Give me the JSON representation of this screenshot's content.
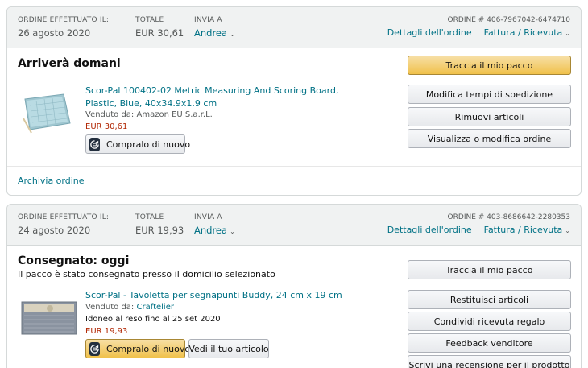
{
  "orders": [
    {
      "header": {
        "placed_label": "ORDINE EFFETTUATO IL:",
        "placed_value": "26 agosto 2020",
        "total_label": "TOTALE",
        "total_value": "EUR 30,61",
        "ship_label": "INVIA A",
        "ship_value": "Andrea",
        "order_number_label": "ORDINE # 406-7967042-6474710",
        "details_link": "Dettagli dell'ordine",
        "invoice_link": "Fattura / Ricevuta"
      },
      "status": "Arriverà domani",
      "item": {
        "title": "Scor-Pal 100402-02 Metric Measuring And Scoring Board, Plastic, Blue, 40x34.9x1.9 cm",
        "seller_prefix": "Venduto da:",
        "seller": "Amazon EU S.a.r.L.",
        "price": "EUR 30,61",
        "buy_again": "Compralo di nuovo"
      },
      "actions": [
        "Traccia il mio pacco",
        "Modifica tempi di spedizione",
        "Rimuovi articoli",
        "Visualizza o modifica ordine"
      ],
      "footer_link": "Archivia ordine"
    },
    {
      "header": {
        "placed_label": "ORDINE EFFETTUATO IL:",
        "placed_value": "24 agosto 2020",
        "total_label": "TOTALE",
        "total_value": "EUR 19,93",
        "ship_label": "INVIA A",
        "ship_value": "Andrea",
        "order_number_label": "ORDINE # 403-8686642-2280353",
        "details_link": "Dettagli dell'ordine",
        "invoice_link": "Fattura / Ricevuta"
      },
      "status": "Consegnato: oggi",
      "status_sub": "Il pacco è stato consegnato presso il domicilio selezionato",
      "item": {
        "title": "Scor-Pal - Tavoletta per segnapunti Buddy, 24 cm x 19 cm",
        "seller_prefix": "Venduto da:",
        "seller": "Craftelier",
        "return_note": "Idoneo al reso fino al 25 set 2020",
        "price": "EUR 19,93",
        "buy_again": "Compralo di nuovo",
        "view_item": "Vedi il tuo articolo"
      },
      "actions": [
        "Traccia il mio pacco",
        "Restituisci articoli",
        "Condividi ricevuta regalo",
        "Feedback venditore",
        "Scrivi una recensione per il prodotto"
      ]
    }
  ],
  "icons": {
    "reorder": "reorder-icon",
    "chevron": "chevron-down-icon"
  },
  "colors": {
    "link": "#007185",
    "price": "#b12704",
    "primary_button": "#f0c14b"
  }
}
